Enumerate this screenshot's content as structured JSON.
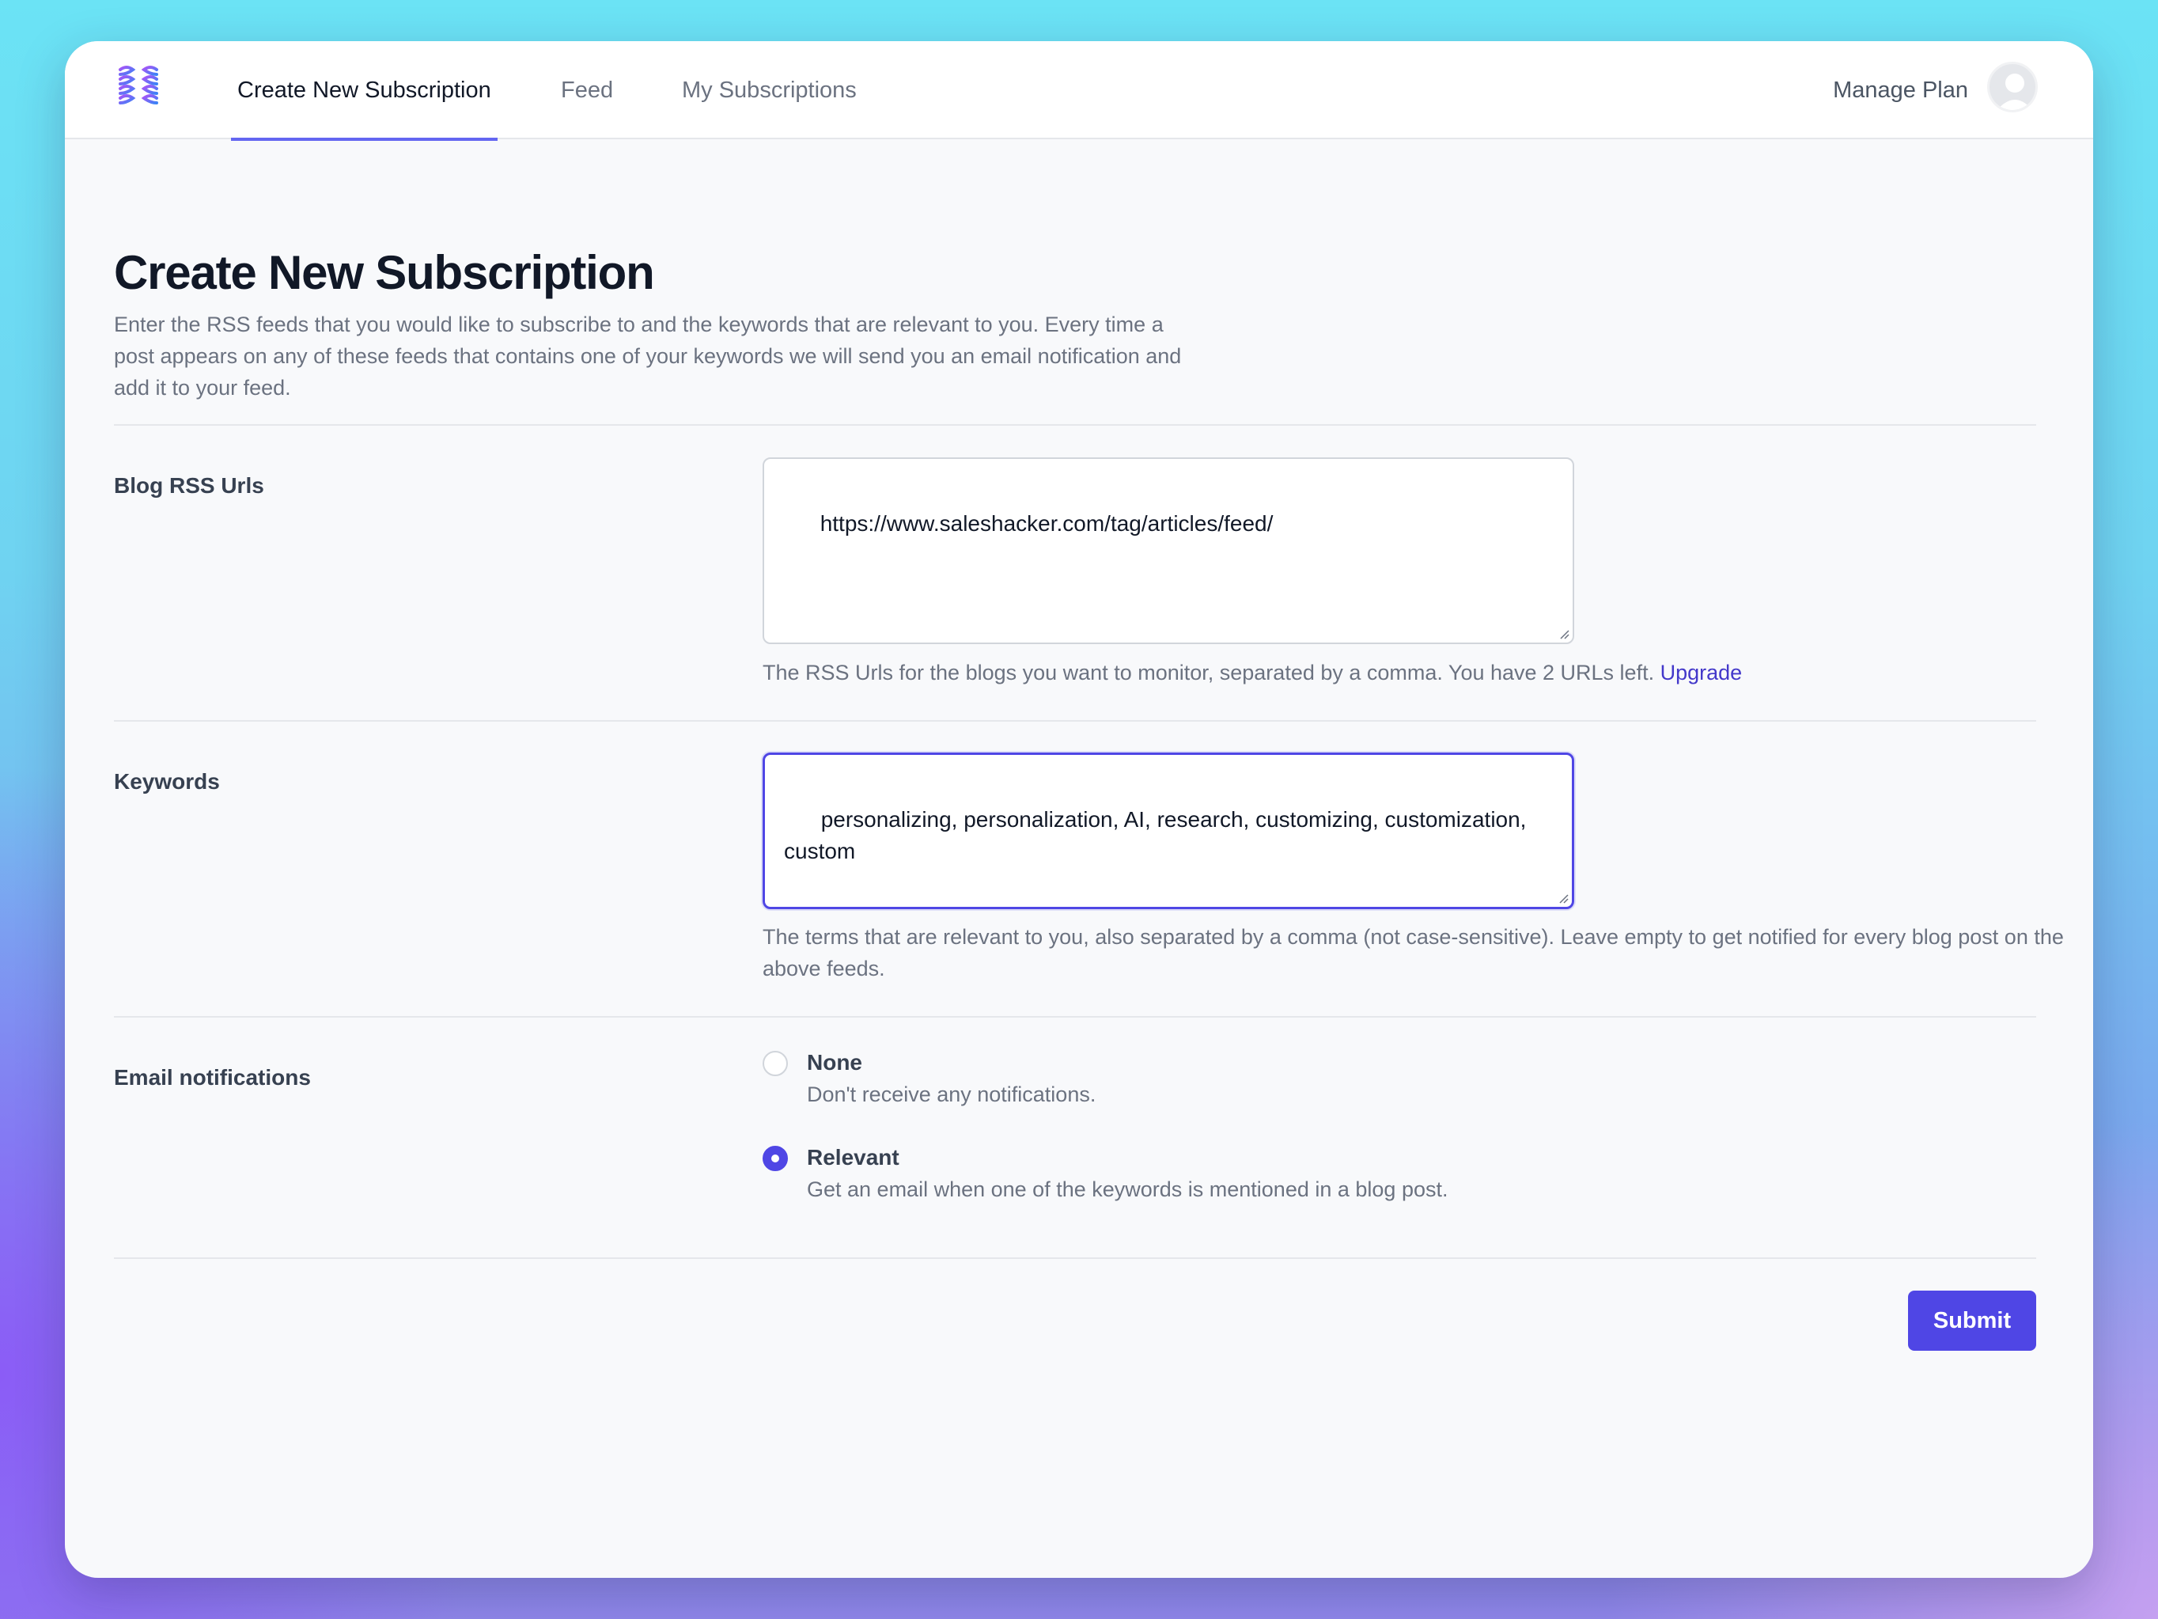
{
  "nav": {
    "logo_icon": "brain-logo-icon",
    "tabs": [
      {
        "label": "Create New Subscription",
        "active": true
      },
      {
        "label": "Feed",
        "active": false
      },
      {
        "label": "My Subscriptions",
        "active": false
      }
    ],
    "manage_plan": "Manage Plan",
    "avatar_icon": "user-avatar-icon"
  },
  "page": {
    "title": "Create New Subscription",
    "description": "Enter the RSS feeds that you would like to subscribe to and the keywords that are relevant to you. Every time a post appears on any of these feeds that contains one of your keywords we will send you an email notification and add it to your feed."
  },
  "form": {
    "rss": {
      "label": "Blog RSS Urls",
      "value": "https://www.saleshacker.com/tag/articles/feed/",
      "help": "The RSS Urls for the blogs you want to monitor, separated by a comma. You have 2 URLs left. ",
      "help_link": "Upgrade"
    },
    "keywords": {
      "label": "Keywords",
      "value": "personalizing, personalization, AI, research, customizing, customization, custom",
      "help": "The terms that are relevant to you, also separated by a comma (not case-sensitive). Leave empty to get notified for every blog post on the above feeds."
    },
    "email": {
      "label": "Email notifications",
      "options": [
        {
          "title": "None",
          "desc": "Don't receive any notifications.",
          "checked": false
        },
        {
          "title": "Relevant",
          "desc": "Get an email when one of the keywords is mentioned in a blog post.",
          "checked": true
        }
      ]
    },
    "submit_label": "Submit"
  },
  "colors": {
    "accent": "#4f46e5",
    "link": "#4338ca"
  }
}
